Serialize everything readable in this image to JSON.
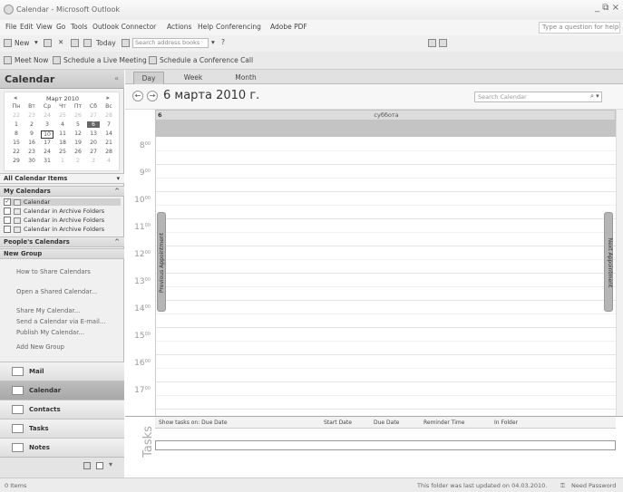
{
  "window": {
    "title": "Calendar - Microsoft Outlook",
    "controls": "_ ⧉ ×"
  },
  "menu": {
    "items": [
      "File",
      "Edit",
      "View",
      "Go",
      "Tools",
      "Outlook Connector",
      "Actions",
      "Help",
      "Conferencing",
      "Adobe PDF"
    ],
    "help_placeholder": "Type a question for help"
  },
  "toolbar": {
    "new_label": "New",
    "today_label": "Today",
    "address_placeholder": "Search address books",
    "meet_now": "Meet Now",
    "schedule_live": "Schedule a Live Meeting",
    "schedule_conf": "Schedule a Conference Call"
  },
  "nav": {
    "title": "Calendar",
    "mini_cal": {
      "month": "Март 2010",
      "weekdays": [
        "Пн",
        "Вт",
        "Ср",
        "Чт",
        "Пт",
        "Сб",
        "Вс"
      ],
      "weeks": [
        [
          "22",
          "23",
          "24",
          "25",
          "26",
          "27",
          "28"
        ],
        [
          "1",
          "2",
          "3",
          "4",
          "5",
          "6",
          "7"
        ],
        [
          "8",
          "9",
          "10",
          "11",
          "12",
          "13",
          "14"
        ],
        [
          "15",
          "16",
          "17",
          "18",
          "19",
          "20",
          "21"
        ],
        [
          "22",
          "23",
          "24",
          "25",
          "26",
          "27",
          "28"
        ],
        [
          "29",
          "30",
          "31",
          "1",
          "2",
          "3",
          "4"
        ]
      ]
    },
    "all_items": "All Calendar Items",
    "my_calendars": "My Calendars",
    "calendars": [
      "Calendar",
      "Calendar in Archive Folders",
      "Calendar in Archive Folders",
      "Calendar in Archive Folders"
    ],
    "peoples_calendars": "People's Calendars",
    "new_group": "New Group",
    "links": [
      "How to Share Calendars",
      "Open a Shared Calendar...",
      "Share My Calendar...",
      "Send a Calendar via E-mail...",
      "Publish My Calendar...",
      "Add New Group"
    ],
    "buttons": [
      "Mail",
      "Calendar",
      "Contacts",
      "Tasks",
      "Notes"
    ]
  },
  "main": {
    "tabs": [
      "Day",
      "Week",
      "Month"
    ],
    "date_title": "6 марта 2010 г.",
    "search_placeholder": "Search Calendar",
    "day_number": "6",
    "day_name": "суббота",
    "hours": [
      "8",
      "9",
      "10",
      "11",
      "12",
      "13",
      "14",
      "15",
      "16",
      "17"
    ],
    "minutes": "00",
    "prev_appointment": "Previous Appointment",
    "next_appointment": "Next Appointment",
    "tasks_label": "Tasks",
    "task_columns": [
      "Show tasks on: Due Date",
      "Start Date",
      "Due Date",
      "Reminder Time",
      "In Folder"
    ]
  },
  "status": {
    "items": "0 Items",
    "updated": "This folder was last updated on 04.03.2010.",
    "password": "Need Password"
  }
}
